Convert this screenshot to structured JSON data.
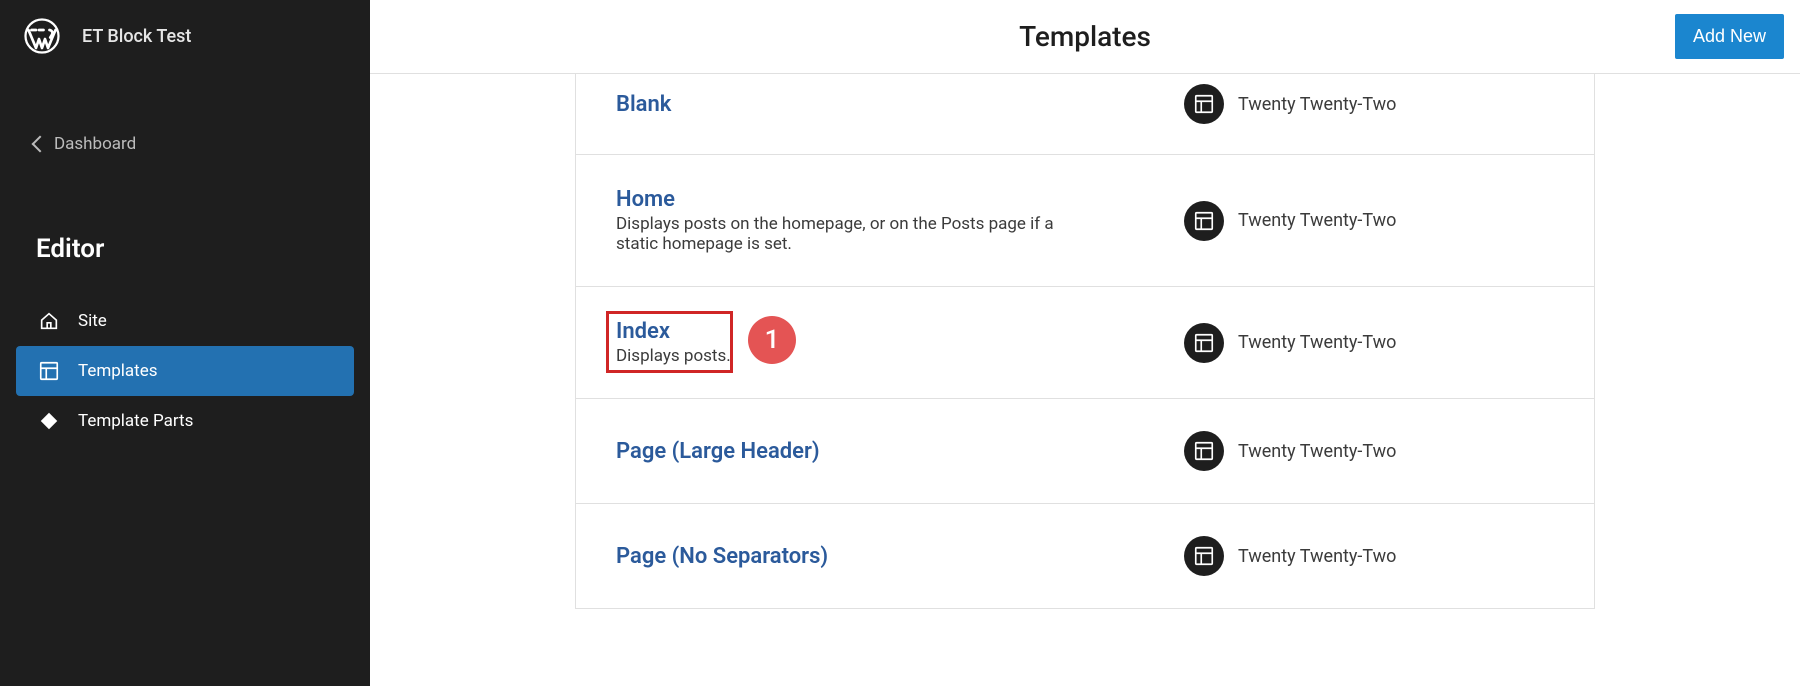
{
  "sidebar": {
    "site_title": "ET Block Test",
    "dashboard_label": "Dashboard",
    "editor_heading": "Editor",
    "nav": [
      {
        "label": "Site",
        "icon": "home-icon",
        "active": false
      },
      {
        "label": "Templates",
        "icon": "layout-icon",
        "active": true
      },
      {
        "label": "Template Parts",
        "icon": "symbol-icon",
        "active": false
      }
    ]
  },
  "header": {
    "title": "Templates",
    "add_new_label": "Add New"
  },
  "templates": [
    {
      "title": "Blank",
      "description": "",
      "theme": "Twenty Twenty-Two",
      "highlighted": false
    },
    {
      "title": "Home",
      "description": "Displays posts on the homepage, or on the Posts page if a static homepage is set.",
      "theme": "Twenty Twenty-Two",
      "highlighted": false
    },
    {
      "title": "Index",
      "description": "Displays posts.",
      "theme": "Twenty Twenty-Two",
      "highlighted": true,
      "badge": "1"
    },
    {
      "title": "Page (Large Header)",
      "description": "",
      "theme": "Twenty Twenty-Two",
      "highlighted": false
    },
    {
      "title": "Page (No Separators)",
      "description": "",
      "theme": "Twenty Twenty-Two",
      "highlighted": false
    }
  ]
}
